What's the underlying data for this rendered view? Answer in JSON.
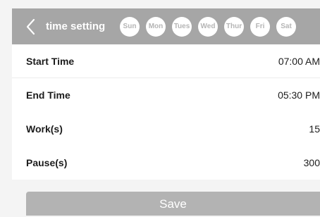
{
  "header": {
    "title": "time setting",
    "days": [
      "Sun",
      "Mon",
      "Tues",
      "Wed",
      "Thur",
      "Fri",
      "Sat"
    ]
  },
  "settings": [
    {
      "label": "Start Time",
      "value": "07:00 AM"
    },
    {
      "label": "End Time",
      "value": "05:30 PM"
    },
    {
      "label": "Work(s)",
      "value": "15"
    },
    {
      "label": "Pause(s)",
      "value": "300"
    }
  ],
  "save_label": "Save",
  "colors": {
    "header_bg": "#a6a6a6",
    "page_bg": "#f4f4f4",
    "day_text": "#b5b5b5",
    "button_bg": "#b3b3b3"
  },
  "icons": {
    "back": "chevron-left-icon"
  }
}
